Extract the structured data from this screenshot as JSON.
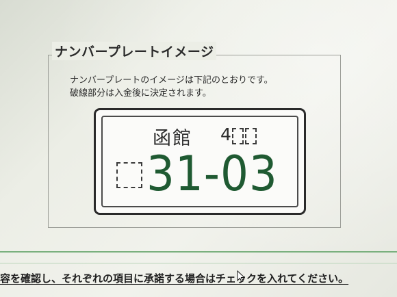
{
  "section": {
    "legend": "ナンバープレートイメージ",
    "description_line1": "ナンバープレートのイメージは下記のとおりです。",
    "description_line2": "破線部分は入金後に決定されます。"
  },
  "plate": {
    "region": "函館",
    "class_digit": "4",
    "number": "31-03",
    "colors": {
      "number": "#1f5a32",
      "border": "#2a2a2a",
      "background": "#fbfbf9"
    }
  },
  "footer": {
    "instruction": "容を確認し、それぞれの項目に承諾する場合はチェックを入れてください。"
  },
  "cursor": {
    "icon": "mouse-pointer-icon"
  }
}
